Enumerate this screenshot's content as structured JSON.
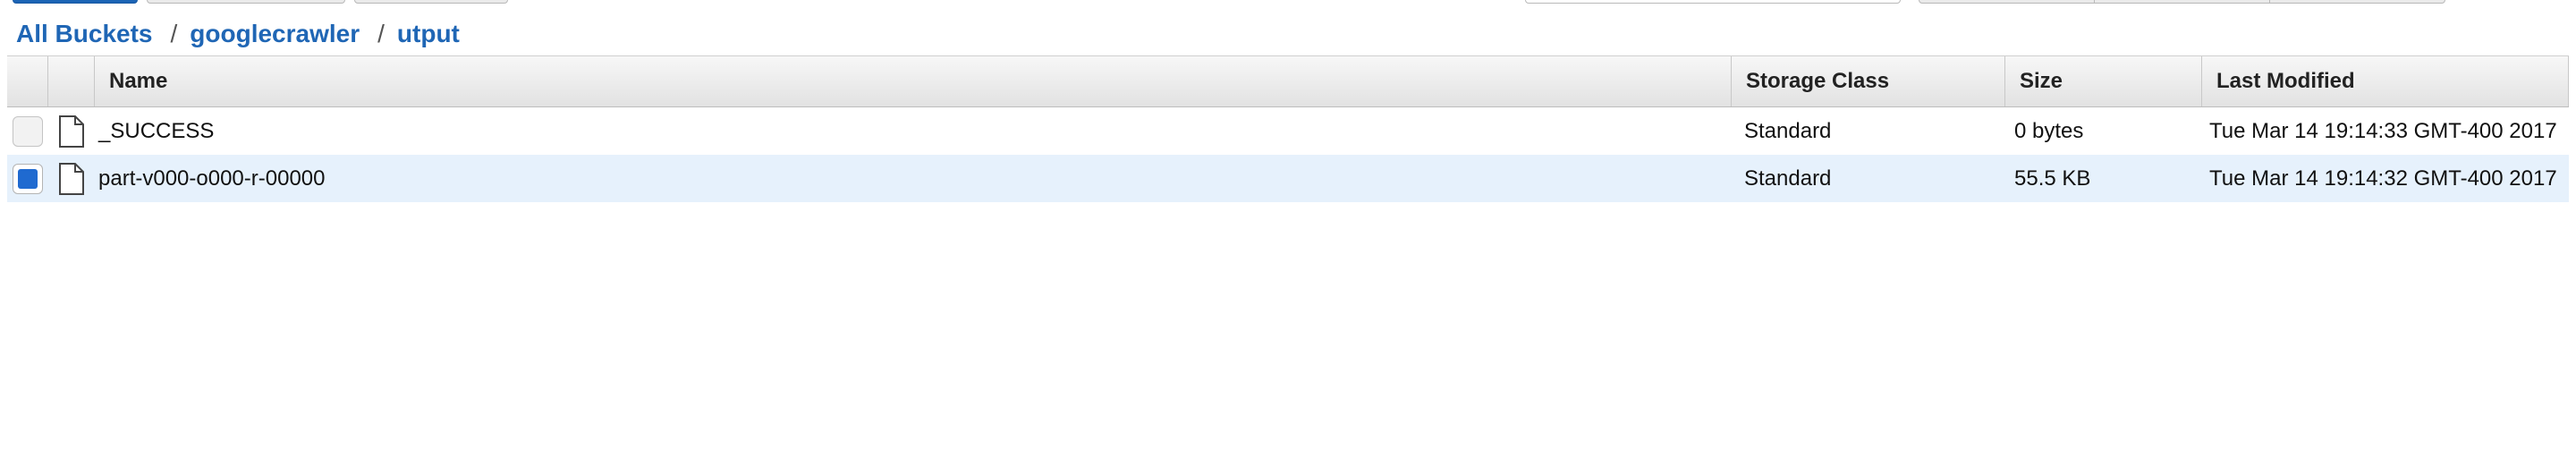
{
  "breadcrumb": {
    "items": [
      {
        "label": "All Buckets"
      },
      {
        "label": "googlecrawler"
      },
      {
        "label": "utput"
      }
    ],
    "separator": "/"
  },
  "table": {
    "columns": {
      "name": "Name",
      "storage_class": "Storage Class",
      "size": "Size",
      "last_modified": "Last Modified"
    },
    "rows": [
      {
        "name": "_SUCCESS",
        "storage_class": "Standard",
        "size": "0 bytes",
        "last_modified": "Tue Mar 14 19:14:33 GMT-400 2017",
        "selected": false,
        "icon": "file-icon"
      },
      {
        "name": "part-v000-o000-r-00000",
        "storage_class": "Standard",
        "size": "55.5 KB",
        "last_modified": "Tue Mar 14 19:14:32 GMT-400 2017",
        "selected": true,
        "icon": "file-icon"
      }
    ]
  },
  "colors": {
    "link": "#1f66b5",
    "selected_row": "#e6f1fc",
    "checkbox_checked": "#1f6ad0",
    "primary_button": "#1b63b3"
  }
}
